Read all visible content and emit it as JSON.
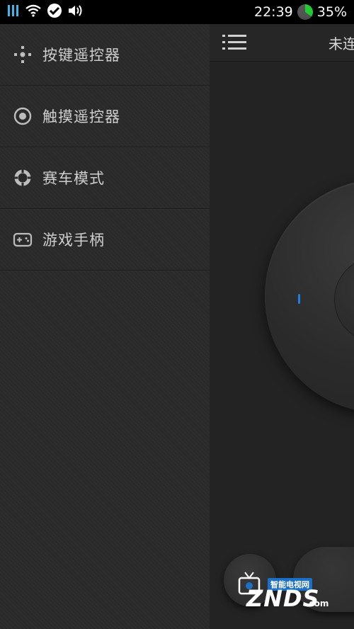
{
  "status_bar": {
    "time": "22:39",
    "battery_percent": "35%",
    "battery_level": 0.35,
    "icons": [
      "app-status-icon",
      "wifi-icon",
      "sync-icon",
      "speaker-icon"
    ]
  },
  "drawer": {
    "items": [
      {
        "label": "按键遥控器",
        "icon": "dpad-icon"
      },
      {
        "label": "触摸遥控器",
        "icon": "touch-target-icon"
      },
      {
        "label": "赛车模式",
        "icon": "steering-wheel-icon"
      },
      {
        "label": "游戏手柄",
        "icon": "gamepad-icon"
      }
    ]
  },
  "main": {
    "header_title": "未连接",
    "menu_icon": "list-menu-icon",
    "accent": "#1e7fe6"
  },
  "watermark": {
    "top": "智能电视网",
    "main": "ZNDS",
    "sub": ".com"
  }
}
